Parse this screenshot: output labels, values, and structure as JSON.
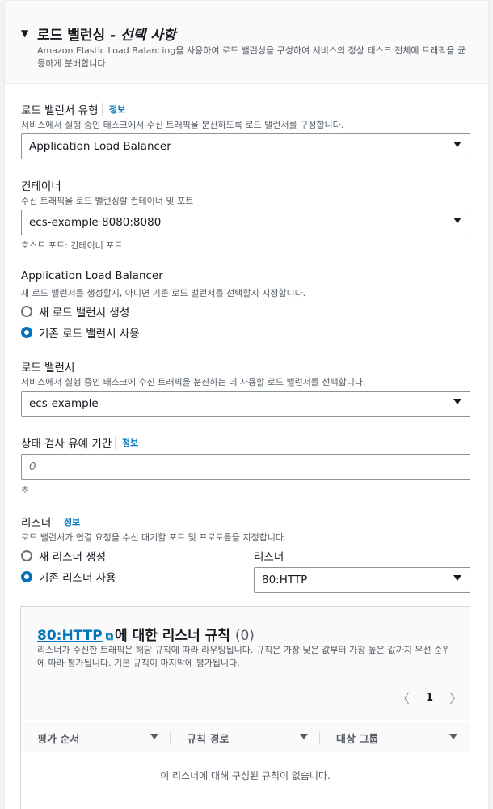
{
  "section": {
    "title": "로드 밸런싱 - ",
    "title_optional": "선택 사항",
    "description": "Amazon Elastic Load Balancing을 사용하여 로드 밸런싱을 구성하여 서비스의 정상 태스크 전체에 트래픽을 균등하게 분배합니다."
  },
  "lb_type": {
    "label": "로드 밸런서 유형",
    "info": "정보",
    "description": "서비스에서 실행 중인 태스크에서 수신 트래픽을 분산하도록 로드 밸런서를 구성합니다.",
    "value": "Application Load Balancer"
  },
  "container": {
    "label": "컨테이너",
    "description": "수신 트래픽을 로드 밸런싱할 컨테이너 및 포트",
    "value": "ecs-example 8080:8080",
    "hint": "호스트 포트: 컨테이너 포트"
  },
  "alb": {
    "label": "Application Load Balancer",
    "description": "새 로드 밸런서를 생성할지, 아니면 기존 로드 밸런서를 선택할지 지정합니다.",
    "options": [
      "새 로드 밸런서 생성",
      "기존 로드 밸런서 사용"
    ],
    "selected_index": 1
  },
  "load_balancer": {
    "label": "로드 밸런서",
    "description": "서비스에서 실행 중인 태스크에 수신 트래픽을 분산하는 데 사용할 로드 밸런서를 선택합니다.",
    "value": "ecs-example"
  },
  "health_check": {
    "label": "상태 검사 유예 기간",
    "info": "정보",
    "placeholder": "0",
    "unit": "초"
  },
  "listener": {
    "label": "리스너",
    "info": "정보",
    "description": "로드 밸런서가 연결 요청을 수신 대기할 포트 및 프로토콜을 지정합니다.",
    "options": [
      "새 리스너 생성",
      "기존 리스너 사용"
    ],
    "selected_index": 1,
    "select_label": "리스너",
    "value": "80:HTTP"
  },
  "rules": {
    "title_link": "80:HTTP",
    "title_suffix": "에 대한 리스너 규칙",
    "count": "(0)",
    "description": "리스너가 수신한 트래픽은 해당 규칙에 따라 라우팅됩니다. 규칙은 가장 낮은 값부터 가장 높은 값까지 우선 순위에 따라 평가됩니다. 기본 규칙이 마지막에 평가됩니다.",
    "page": "1",
    "columns": [
      "평가 순서",
      "규칙 경로",
      "대상 그룹"
    ],
    "empty_message": "이 리스너에 대해 구성된 규칙이 없습니다."
  },
  "colors": {
    "link": "#0073bb",
    "selected_radio": "#0073bb"
  }
}
